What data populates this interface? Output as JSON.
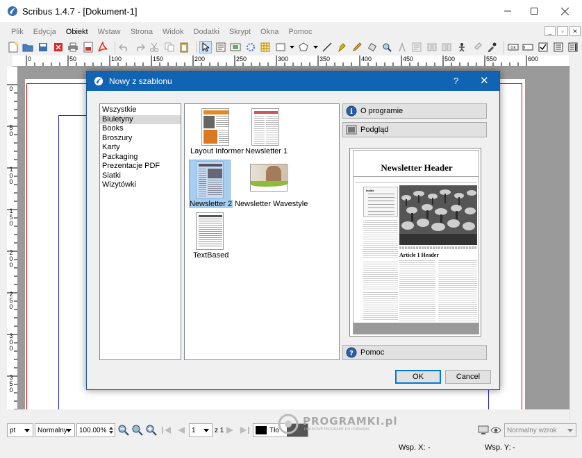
{
  "window": {
    "title": "Scribus 1.4.7 - [Dokument-1]"
  },
  "menu": [
    "Plik",
    "Edycja",
    "Obiekt",
    "Wstaw",
    "Strona",
    "Widok",
    "Dodatki",
    "Skrypt",
    "Okna",
    "Pomoc"
  ],
  "menu_active_index": 2,
  "ruler": {
    "h_labels": [
      "0",
      "50",
      "100",
      "150",
      "200",
      "250",
      "300",
      "350",
      "400",
      "450",
      "500",
      "550",
      "600"
    ],
    "v_labels": [
      "0",
      "5 0",
      "1 0 0",
      "1 5 0",
      "2 0 0",
      "2 5 0",
      "3 0 0",
      "3 5 0"
    ]
  },
  "dialog": {
    "title": "Nowy z szablonu",
    "help_glyph": "?",
    "close_glyph": "✕",
    "categories": [
      "Wszystkie",
      "Biuletyny",
      "Books",
      "Broszury",
      "Karty",
      "Packaging",
      "Prezentacje PDF",
      "Siatki",
      "Wizytówki"
    ],
    "selected_category": 1,
    "templates": [
      "Layout Informer",
      "Newsletter 1",
      "Newsletter 2",
      "Newsletter Wavestyle",
      "TextBased"
    ],
    "selected_template": 2,
    "about_button": "O programie",
    "preview_button": "Podgląd",
    "help_button": "Pomoc",
    "ok_button": "OK",
    "cancel_button": "Cancel",
    "preview": {
      "header": "Newsletter Header",
      "article": "Article 1 Header",
      "inside": "Inside"
    }
  },
  "status": {
    "unit": "pt",
    "mode": "Normalny",
    "zoom": "100.00%",
    "page": "1",
    "page_of": "z 1",
    "layer": "Tło",
    "preview_mode": "Normalny wzrok",
    "x_label": "Wsp. X:",
    "x_value": "-",
    "y_label": "Wsp. Y:",
    "y_value": "-"
  },
  "watermark": {
    "text": "PROGRAMKI.pl",
    "sub": "DARMOWE PROGRAMY DO POBRANIA"
  }
}
